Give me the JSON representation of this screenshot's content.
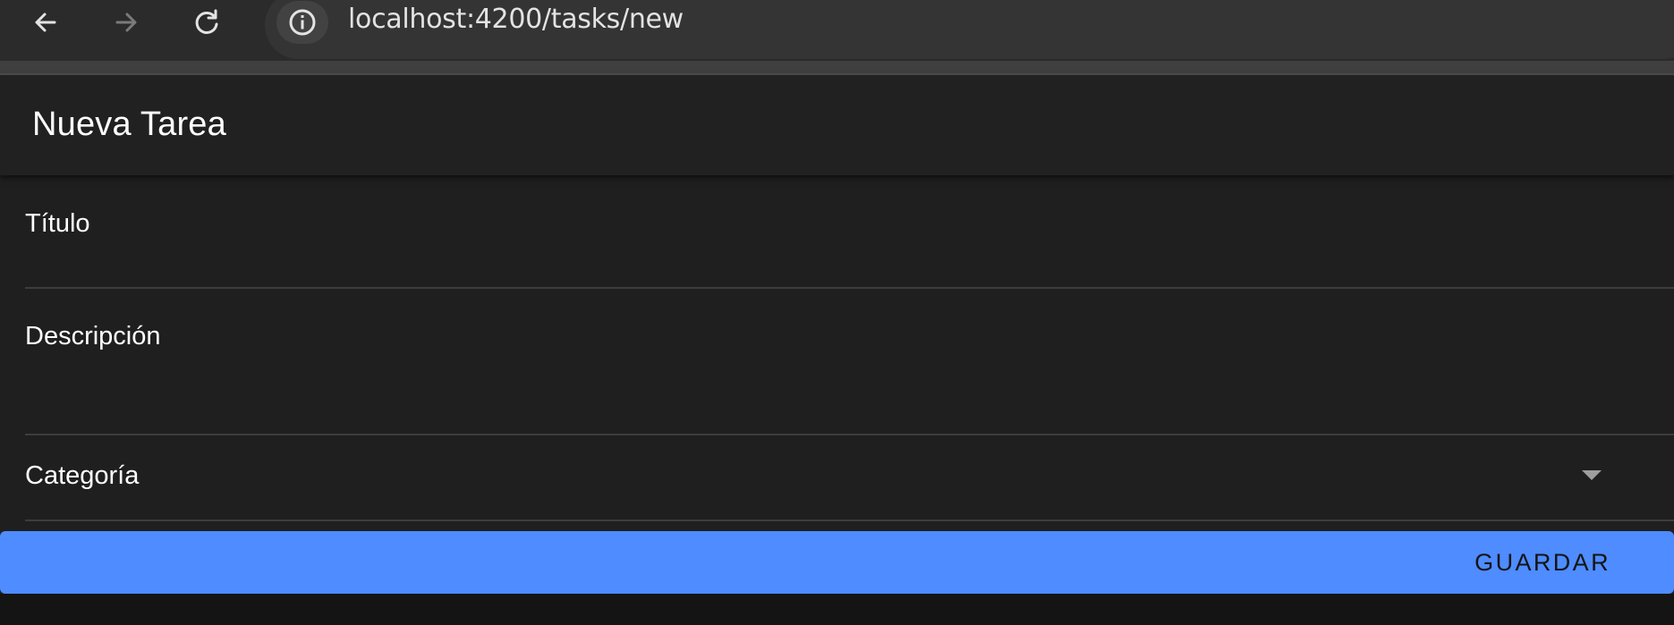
{
  "browser": {
    "url": "localhost:4200/tasks/new",
    "icons": {
      "back": "arrow-left-icon",
      "forward": "arrow-right-icon",
      "reload": "reload-icon",
      "site_info": "info-icon"
    }
  },
  "toolbar": {
    "title": "Nueva Tarea"
  },
  "form": {
    "fields": {
      "titulo": {
        "label": "Título",
        "value": ""
      },
      "descripcion": {
        "label": "Descripción",
        "value": ""
      },
      "categoria": {
        "label": "Categoría",
        "selected": ""
      }
    },
    "save_label": "GUARDAR"
  },
  "colors": {
    "accent": "#4e8cff",
    "surface": "#1f1f1f",
    "toolbar": "#212121",
    "background": "#141414"
  }
}
